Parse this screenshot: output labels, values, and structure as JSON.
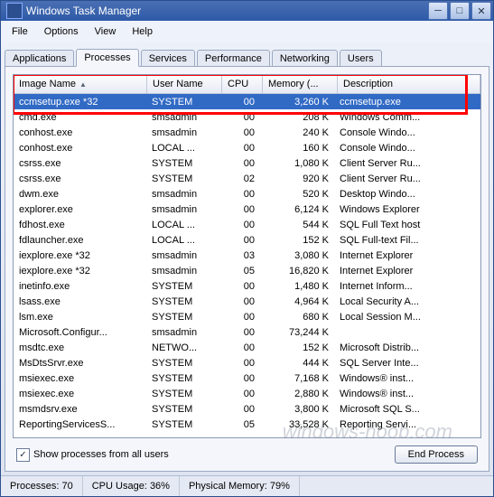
{
  "window": {
    "title": "Windows Task Manager"
  },
  "menu": [
    "File",
    "Options",
    "View",
    "Help"
  ],
  "tabs": [
    "Applications",
    "Processes",
    "Services",
    "Performance",
    "Networking",
    "Users"
  ],
  "active_tab": 1,
  "columns": [
    "Image Name",
    "User Name",
    "CPU",
    "Memory (...",
    "Description"
  ],
  "sort_col": 0,
  "processes": [
    {
      "name": "ccmsetup.exe *32",
      "user": "SYSTEM",
      "cpu": "00",
      "mem": "3,260 K",
      "desc": "ccmsetup.exe",
      "sel": true
    },
    {
      "name": "cmd.exe",
      "user": "smsadmin",
      "cpu": "00",
      "mem": "208 K",
      "desc": "Windows Comm..."
    },
    {
      "name": "conhost.exe",
      "user": "smsadmin",
      "cpu": "00",
      "mem": "240 K",
      "desc": "Console Windo..."
    },
    {
      "name": "conhost.exe",
      "user": "LOCAL ...",
      "cpu": "00",
      "mem": "160 K",
      "desc": "Console Windo..."
    },
    {
      "name": "csrss.exe",
      "user": "SYSTEM",
      "cpu": "00",
      "mem": "1,080 K",
      "desc": "Client Server Ru..."
    },
    {
      "name": "csrss.exe",
      "user": "SYSTEM",
      "cpu": "02",
      "mem": "920 K",
      "desc": "Client Server Ru..."
    },
    {
      "name": "dwm.exe",
      "user": "smsadmin",
      "cpu": "00",
      "mem": "520 K",
      "desc": "Desktop Windo..."
    },
    {
      "name": "explorer.exe",
      "user": "smsadmin",
      "cpu": "00",
      "mem": "6,124 K",
      "desc": "Windows Explorer"
    },
    {
      "name": "fdhost.exe",
      "user": "LOCAL ...",
      "cpu": "00",
      "mem": "544 K",
      "desc": "SQL Full Text host"
    },
    {
      "name": "fdlauncher.exe",
      "user": "LOCAL ...",
      "cpu": "00",
      "mem": "152 K",
      "desc": "SQL Full-text Fil..."
    },
    {
      "name": "iexplore.exe *32",
      "user": "smsadmin",
      "cpu": "03",
      "mem": "3,080 K",
      "desc": "Internet Explorer"
    },
    {
      "name": "iexplore.exe *32",
      "user": "smsadmin",
      "cpu": "05",
      "mem": "16,820 K",
      "desc": "Internet Explorer"
    },
    {
      "name": "inetinfo.exe",
      "user": "SYSTEM",
      "cpu": "00",
      "mem": "1,480 K",
      "desc": "Internet Inform..."
    },
    {
      "name": "lsass.exe",
      "user": "SYSTEM",
      "cpu": "00",
      "mem": "4,964 K",
      "desc": "Local Security A..."
    },
    {
      "name": "lsm.exe",
      "user": "SYSTEM",
      "cpu": "00",
      "mem": "680 K",
      "desc": "Local Session M..."
    },
    {
      "name": "Microsoft.Configur...",
      "user": "smsadmin",
      "cpu": "00",
      "mem": "73,244 K",
      "desc": ""
    },
    {
      "name": "msdtc.exe",
      "user": "NETWO...",
      "cpu": "00",
      "mem": "152 K",
      "desc": "Microsoft Distrib..."
    },
    {
      "name": "MsDtsSrvr.exe",
      "user": "SYSTEM",
      "cpu": "00",
      "mem": "444 K",
      "desc": "SQL Server Inte..."
    },
    {
      "name": "msiexec.exe",
      "user": "SYSTEM",
      "cpu": "00",
      "mem": "7,168 K",
      "desc": "Windows® inst..."
    },
    {
      "name": "msiexec.exe",
      "user": "SYSTEM",
      "cpu": "00",
      "mem": "2,880 K",
      "desc": "Windows® inst..."
    },
    {
      "name": "msmdsrv.exe",
      "user": "SYSTEM",
      "cpu": "00",
      "mem": "3,800 K",
      "desc": "Microsoft SQL S..."
    },
    {
      "name": "ReportingServicesS...",
      "user": "SYSTEM",
      "cpu": "05",
      "mem": "33,528 K",
      "desc": "Reporting Servi..."
    }
  ],
  "checkbox": {
    "label": "Show processes from all users",
    "checked": true
  },
  "end_button": "End Process",
  "status": {
    "procs_label": "Processes:",
    "procs": "70",
    "cpu_label": "CPU Usage:",
    "cpu": "36%",
    "mem_label": "Physical Memory:",
    "mem": "79%"
  },
  "watermark": "windows-noob.com"
}
